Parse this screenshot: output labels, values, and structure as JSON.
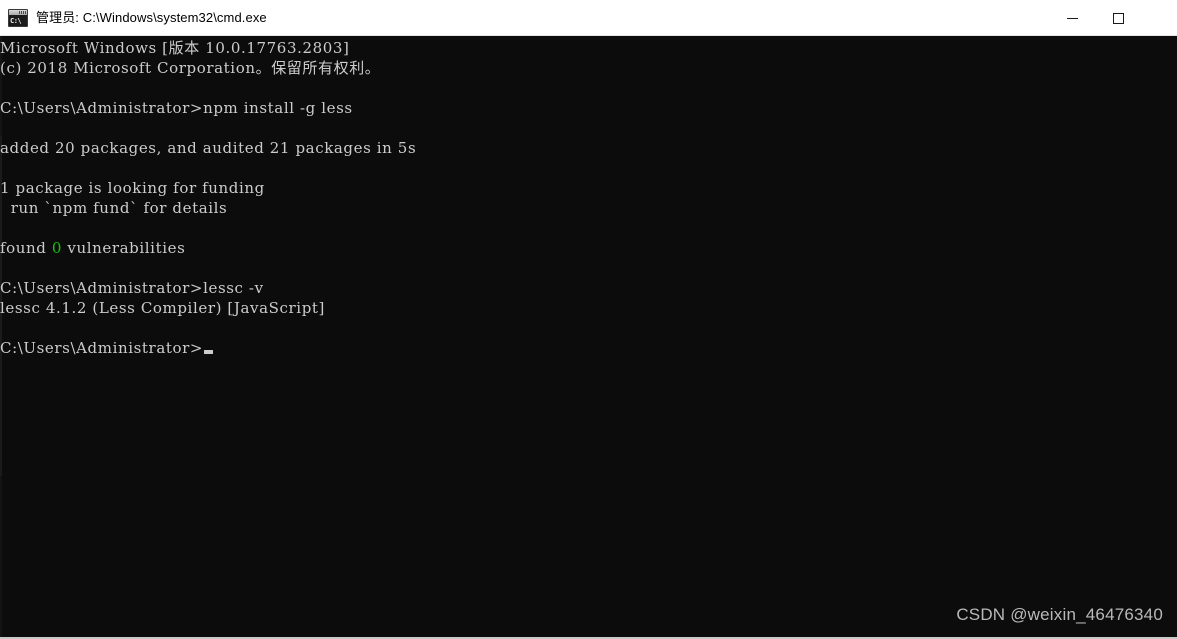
{
  "window": {
    "title": "管理员: C:\\Windows\\system32\\cmd.exe",
    "icon": "cmd-console-icon",
    "icon_label": "C:\\",
    "background_color": "#0d0c0c",
    "titlebar_color": "#ffffff"
  },
  "titlebar_controls": {
    "minimize_label": "—",
    "maximize_label": "□"
  },
  "console": {
    "foreground_color": "#cccccc",
    "success_color": "#13c40e",
    "prompt": "C:\\Users\\Administrator>",
    "cursor": "block",
    "lines": [
      {
        "text": "Microsoft Windows [版本 10.0.17763.2803]"
      },
      {
        "text": "(c) 2018 Microsoft Corporation。保留所有权利。"
      },
      {
        "text": ""
      },
      {
        "text": "C:\\Users\\Administrator>npm install -g less"
      },
      {
        "text": ""
      },
      {
        "text": "added 20 packages, and audited 21 packages in 5s"
      },
      {
        "text": ""
      },
      {
        "text": "1 package is looking for funding"
      },
      {
        "text": "  run `npm fund` for details"
      },
      {
        "text": ""
      },
      {
        "text": "found 0 vulnerabilities",
        "segments": [
          {
            "text": "found ",
            "color": "fg"
          },
          {
            "text": "0",
            "color": "green"
          },
          {
            "text": " vulnerabilities",
            "color": "fg"
          }
        ]
      },
      {
        "text": ""
      },
      {
        "text": "C:\\Users\\Administrator>lessc -v"
      },
      {
        "text": "lessc 4.1.2 (Less Compiler) [JavaScript]"
      },
      {
        "text": ""
      },
      {
        "text": "C:\\Users\\Administrator>",
        "cursor_after": true
      }
    ]
  },
  "commands_entered": [
    "npm install -g less",
    "lessc -v"
  ],
  "results": {
    "packages_added": 20,
    "packages_audited": 21,
    "install_time": "5s",
    "packages_looking_for_funding": 1,
    "vulnerabilities": 0,
    "lessc_version": "4.1.2",
    "lessc_description": "(Less Compiler) [JavaScript]"
  },
  "watermark": {
    "text": "CSDN @weixin_46476340"
  }
}
